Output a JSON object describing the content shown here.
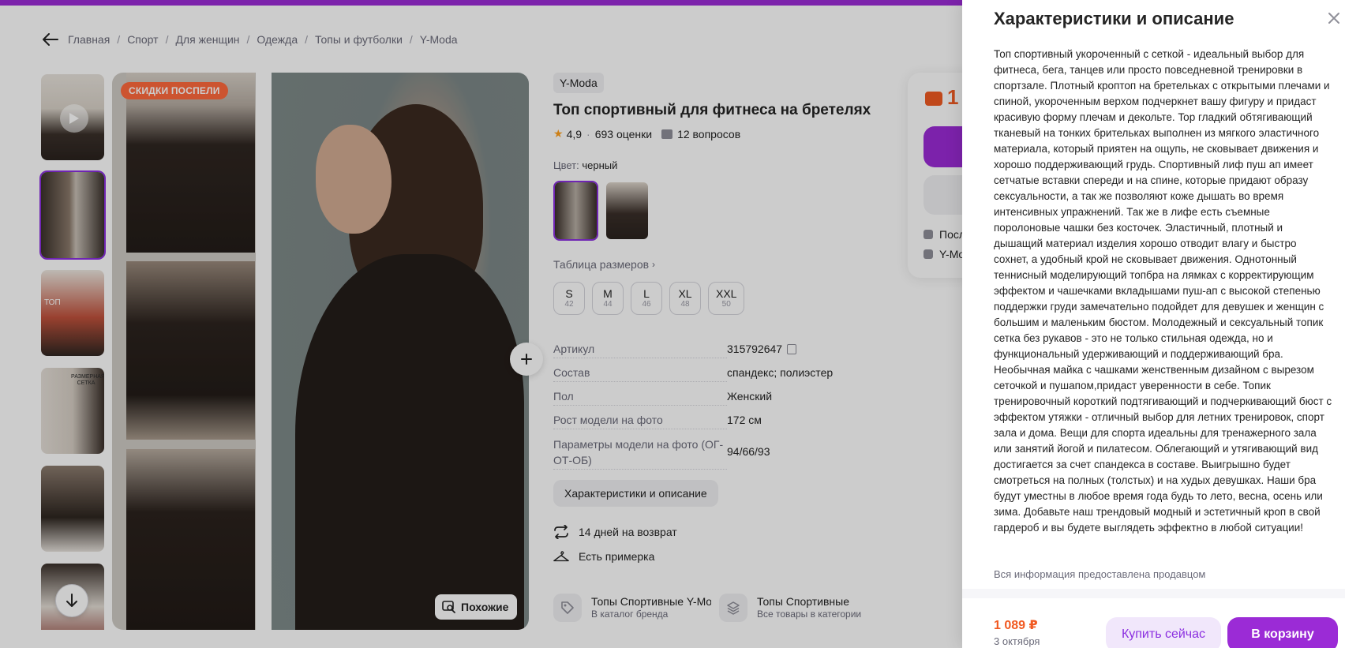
{
  "colors": {
    "accent": "#9b2bd6",
    "price": "#f15a22",
    "sale_badge": "#ff6a3d",
    "rating_star": "#ff9f1c"
  },
  "breadcrumb": {
    "back_icon": "arrow-left-icon",
    "items": [
      "Главная",
      "Спорт",
      "Для женщин",
      "Одежда",
      "Топы и футболки",
      "Y-Moda"
    ],
    "separator": "/"
  },
  "gallery": {
    "sale_badge": "СКИДКИ ПОСПЕЛИ",
    "similar_label": "Похожие",
    "thumb_texts": [
      "ТОП",
      "РАЗМЕРНАЯ СЕТКА"
    ]
  },
  "product": {
    "brand": "Y-Moda",
    "title": "Топ спортивный для фитнеса на бретелях",
    "rating": "4,9",
    "reviews": "693 оценки",
    "questions": "12 вопросов",
    "color_label": "Цвет:",
    "color_value": "черный",
    "size_table_label": "Таблица размеров",
    "sizes": [
      {
        "name": "S",
        "code": "42"
      },
      {
        "name": "M",
        "code": "44"
      },
      {
        "name": "L",
        "code": "46"
      },
      {
        "name": "XL",
        "code": "48"
      },
      {
        "name": "XXL",
        "code": "50"
      }
    ]
  },
  "specs": {
    "article_label": "Артикул",
    "article_value": "315792647",
    "composition_label": "Состав",
    "composition_value": "спандекс; полиэстер",
    "gender_label": "Пол",
    "gender_value": "Женский",
    "height_label": "Рост модели на фото",
    "height_value": "172 см",
    "params_label": "Параметры модели на фото (ОГ-ОТ-ОБ)",
    "params_value": "94/66/93"
  },
  "description_button": "Характеристики и описание",
  "features": {
    "return": "14 дней на возврат",
    "fitting": "Есть примерка"
  },
  "bottom_cards": {
    "brand_title": "Топы Спортивные Y-Moda",
    "brand_sub": "В каталог бренда",
    "category_title": "Топы Спортивные",
    "category_sub": "Все товары в категории"
  },
  "price_card": {
    "price_partial": "1",
    "line1": "Посл",
    "line2": "Y-Mo"
  },
  "drawer": {
    "title": "Характеристики и описание",
    "close_icon": "close-icon",
    "description": "Топ спортивный укороченный с сеткой - идеальный выбор для фитнеса, бега, танцев или просто повседневной тренировки в спортзале. Плотный кроптоп на бретельках с открытыми плечами и спиной, укороченным верхом подчеркнет вашу фигуру и придаст красивую форму плечам и декольте. Top гладкий обтягивающий тканевый на тонких брительках выполнен из мягкого эластичного материала, который приятен на ощупь, не сковывает движения и хорошо поддерживающий грудь. Спортивный лиф пуш ап имеет сетчатые вставки спереди и на спине, которые придают образу сексуальности, а так же позволяют коже дышать во время интенсивных упражнений. Так же в лифе есть съемные поролоновые чашки без косточек. Эластичный, плотный и дышащий материал изделия хорошо отводит влагу и быстро сохнет, а удобный крой не сковывает движения. Однотонный теннисный моделирующий топбра на лямках с корректирующим эффектом и чашечками вкладышами пуш-ап с высокой степенью поддержки груди замечательно подойдет для девушек и женщин с большим и маленьким бюстом. Молодежный и сексуальный топик сетка без рукавов - это не только стильная одежда, но и функциональный удерживающий и поддерживающий бра. Необычная майка с чашками женственным дизайном с вырезом сеточкой и пушапом,придаст уверенности в себе. Топик тренировочный короткий подтягивающий и подчеркивающий бюст с эффектом утяжки - отличный выбор для летних тренировок, спорт зала и дома. Вещи для спорта идеальны для тренажерного зала или занятий йогой и пилатесом. Облегающий и утягивающий вид достигается за счет спандекса в составе. Выигрышно будет смотреться на полных (толстых) и на худых девушках. Наши бра будут уместны в любое время года будь то лето, весна, осень или зима. Добавьте наш трендовый модный и эстетичный кроп в свой гардероб и вы будете выглядеть эффектно в любой ситуации!",
    "seller_note": "Вся информация предоставлена продавцом",
    "footer_price": "1 089 ₽",
    "footer_date": "3 октября",
    "buy_now": "Купить сейчас",
    "add_to_cart": "В корзину"
  }
}
